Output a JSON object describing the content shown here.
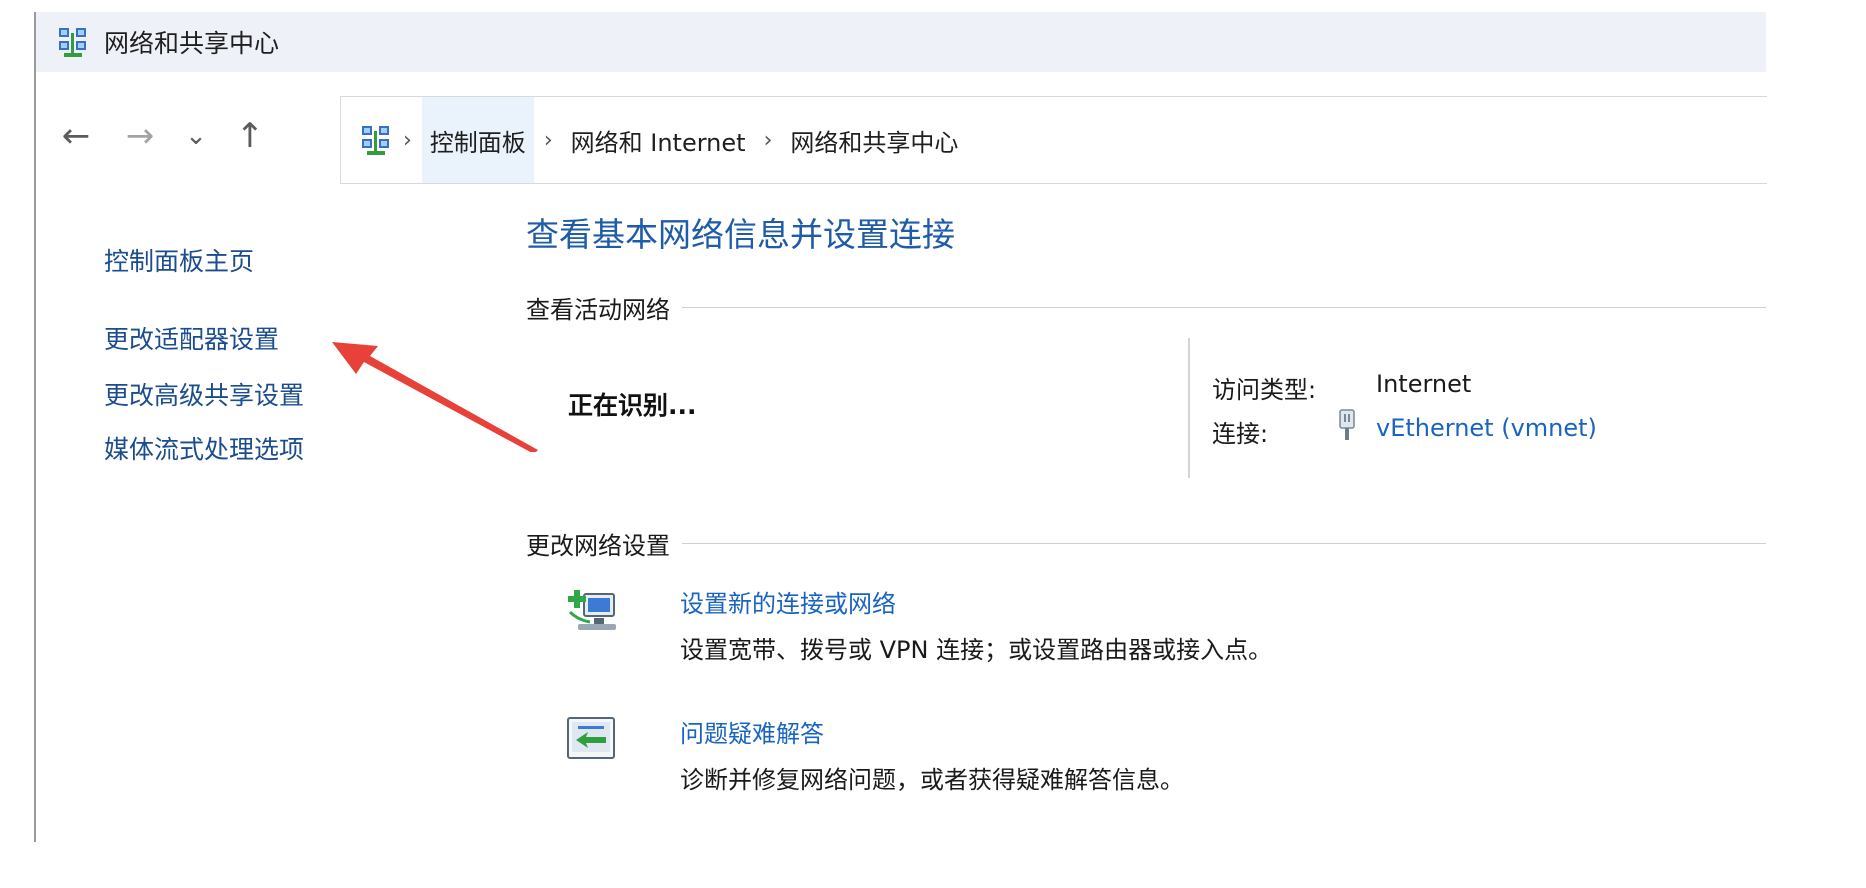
{
  "window": {
    "title": "网络和共享中心",
    "title_icon": "network-sharing-center-icon"
  },
  "navigation": {
    "back_icon": "arrow-left-icon",
    "forward_icon": "arrow-right-icon",
    "recent_icon": "chevron-down-icon",
    "up_icon": "arrow-up-icon",
    "back_glyph": "←",
    "forward_glyph": "→",
    "recent_glyph": "⌄",
    "up_glyph": "↑"
  },
  "breadcrumb": {
    "separator": "›",
    "items": [
      "控制面板",
      "网络和 Internet",
      "网络和共享中心"
    ]
  },
  "sidebar": {
    "items": [
      "控制面板主页",
      "更改适配器设置",
      "更改高级共享设置",
      "媒体流式处理选项"
    ]
  },
  "main": {
    "title": "查看基本网络信息并设置连接",
    "active_networks": {
      "heading": "查看活动网络",
      "network_status": "正在识别...",
      "access_type_label": "访问类型:",
      "access_type_value": "Internet",
      "connection_label": "连接:",
      "connection_value": "vEthernet (vmnet)",
      "connection_icon": "ethernet-plug-icon"
    },
    "change_settings": {
      "heading": "更改网络设置",
      "tasks": [
        {
          "icon": "new-connection-icon",
          "link": "设置新的连接或网络",
          "description": "设置宽带、拨号或 VPN 连接；或设置路由器或接入点。"
        },
        {
          "icon": "troubleshoot-icon",
          "link": "问题疑难解答",
          "description": "诊断并修复网络问题，或者获得疑难解答信息。"
        }
      ]
    }
  },
  "colors": {
    "link": "#1a64c0",
    "sidebar_link": "#1a4c8f",
    "title": "#1e5ba8",
    "titlebar_bg": "#eef2f8",
    "annotation_arrow": "#e8413a"
  }
}
